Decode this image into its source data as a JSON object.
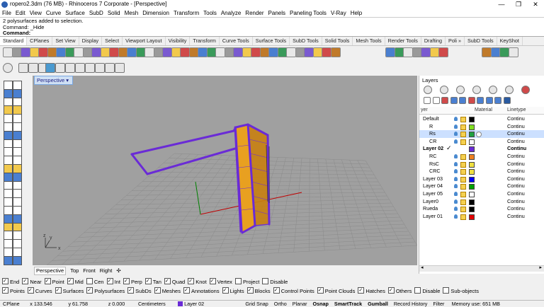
{
  "window": {
    "title": "ropero2.3dm (76 MB) - Rhinoceros 7 Corporate - [Perspective]",
    "minimize": "—",
    "maximize": "❐",
    "close": "✕"
  },
  "menu": [
    "File",
    "Edit",
    "View",
    "Curve",
    "Surface",
    "SubD",
    "Solid",
    "Mesh",
    "Dimension",
    "Transform",
    "Tools",
    "Analyze",
    "Render",
    "Panels",
    "Paneling Tools",
    "V-Ray",
    "Help"
  ],
  "command": {
    "history1": "2 polysurfaces added to selection.",
    "history2": "Command: _Hide",
    "prompt": "Command:"
  },
  "toolbar_tabs": [
    "Standard",
    "CPlanes",
    "Set View",
    "Display",
    "Select",
    "Viewport Layout",
    "Visibility",
    "Transform",
    "Curve Tools",
    "Surface Tools",
    "SubD Tools",
    "Solid Tools",
    "Mesh Tools",
    "Render Tools",
    "Drafting",
    "Poli »",
    "SubD Tools",
    "KeyShot"
  ],
  "viewport": {
    "title": "Perspective",
    "tabs": [
      "Perspective",
      "Top",
      "Front",
      "Right"
    ],
    "add_tab": "✣",
    "axis_x": "x",
    "axis_y": "y",
    "axis_z": "z"
  },
  "osnap": {
    "row1": [
      {
        "label": "End",
        "on": true
      },
      {
        "label": "Near",
        "on": true
      },
      {
        "label": "Point",
        "on": true
      },
      {
        "label": "Mid",
        "on": true
      },
      {
        "label": "Cen",
        "on": false
      },
      {
        "label": "Int",
        "on": true
      },
      {
        "label": "Perp",
        "on": true
      },
      {
        "label": "Tan",
        "on": true
      },
      {
        "label": "Quad",
        "on": true
      },
      {
        "label": "Knot",
        "on": true
      },
      {
        "label": "Vertex",
        "on": true
      },
      {
        "label": "Project",
        "on": false
      },
      {
        "label": "Disable",
        "on": false
      }
    ],
    "row2": [
      {
        "label": "Points",
        "on": true
      },
      {
        "label": "Curves",
        "on": true
      },
      {
        "label": "Surfaces",
        "on": true
      },
      {
        "label": "Polysurfaces",
        "on": true
      },
      {
        "label": "SubDs",
        "on": true
      },
      {
        "label": "Meshes",
        "on": true
      },
      {
        "label": "Annotations",
        "on": true
      },
      {
        "label": "Lights",
        "on": true
      },
      {
        "label": "Blocks",
        "on": true
      },
      {
        "label": "Control Points",
        "on": true
      },
      {
        "label": "Point Clouds",
        "on": true
      },
      {
        "label": "Hatches",
        "on": true
      },
      {
        "label": "Others",
        "on": true
      },
      {
        "label": "Disable",
        "on": false
      },
      {
        "label": "Sub-objects",
        "on": false
      }
    ]
  },
  "status": {
    "cplane": "CPlane",
    "x": "x 133.546",
    "y": "y 61.758",
    "z": "z 0.000",
    "units": "Centimeters",
    "layer": "Layer 02",
    "layer_color": "#6a2bd6",
    "toggles": [
      "Grid Snap",
      "Ortho",
      "Planar",
      "Osnap",
      "SmartTrack",
      "Gumball",
      "Record History",
      "Filter"
    ],
    "memory": "Memory use: 651 MB"
  },
  "layers_panel": {
    "title": "Layers",
    "col_layer": "yer",
    "col_material": "Material",
    "col_linetype": "Linetype",
    "rows": [
      {
        "name": "Default",
        "indent": 0,
        "color": "#000000",
        "linetype": "Continu",
        "bold": false,
        "selected": false,
        "current": false
      },
      {
        "name": "R",
        "indent": 1,
        "color": "#80e020",
        "linetype": "Continu",
        "bold": false,
        "selected": false,
        "current": false
      },
      {
        "name": "Rs",
        "indent": 1,
        "color": "#20a040",
        "linetype": "Continu",
        "bold": false,
        "selected": true,
        "current": false
      },
      {
        "name": "CR",
        "indent": 1,
        "color": "#ffffff",
        "linetype": "Continu",
        "bold": false,
        "selected": false,
        "current": false
      },
      {
        "name": "Layer 02",
        "indent": 0,
        "color": "#6a2bd6",
        "linetype": "Continu",
        "bold": true,
        "selected": false,
        "current": true
      },
      {
        "name": "RC",
        "indent": 1,
        "color": "#f08020",
        "linetype": "Continu",
        "bold": false,
        "selected": false,
        "current": false
      },
      {
        "name": "RsC",
        "indent": 1,
        "color": "#f0e040",
        "linetype": "Continu",
        "bold": false,
        "selected": false,
        "current": false
      },
      {
        "name": "CRC",
        "indent": 1,
        "color": "#f0e040",
        "linetype": "Continu",
        "bold": false,
        "selected": false,
        "current": false
      },
      {
        "name": "Layer 03",
        "indent": 0,
        "color": "#0000ff",
        "linetype": "Continu",
        "bold": false,
        "selected": false,
        "current": false
      },
      {
        "name": "Layer 04",
        "indent": 0,
        "color": "#00a000",
        "linetype": "Continu",
        "bold": false,
        "selected": false,
        "current": false
      },
      {
        "name": "Layer 05",
        "indent": 0,
        "color": "#ffffff",
        "linetype": "Continu",
        "bold": false,
        "selected": false,
        "current": false
      },
      {
        "name": "Layer0",
        "indent": 0,
        "color": "#000000",
        "linetype": "Continu",
        "bold": false,
        "selected": false,
        "current": false
      },
      {
        "name": "Rueda",
        "indent": 0,
        "color": "#000000",
        "linetype": "Continu",
        "bold": false,
        "selected": false,
        "current": false
      },
      {
        "name": "Layer 01",
        "indent": 0,
        "color": "#e00000",
        "linetype": "Continu",
        "bold": false,
        "selected": false,
        "current": false
      }
    ]
  },
  "colors": {
    "purple": "#6a2bd6",
    "orange": "#e8a020",
    "grid": "#8a8a8a",
    "viewport_bg": "#a0a0a0",
    "axis_x": "#c00000",
    "axis_y": "#008000"
  }
}
